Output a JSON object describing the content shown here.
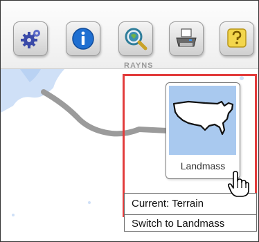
{
  "toolbar": {
    "buttons": [
      {
        "icon": "gear-icon",
        "accent": "#3a4aa8"
      },
      {
        "icon": "info-icon",
        "accent": "#1f6fd1"
      },
      {
        "icon": "magnifier-globe-icon",
        "accent": "#2e7d9a"
      },
      {
        "icon": "printer-icon",
        "accent": "#555555"
      },
      {
        "icon": "help-icon",
        "accent": "#e9c22e"
      }
    ],
    "section_label": "RAYNS"
  },
  "basemap_switcher": {
    "option_label": "Landmass",
    "highlight_color": "#e23c3c",
    "thumbnail_color": "#a9c9ef"
  },
  "tooltip": {
    "current": "Current: Terrain",
    "action": "Switch to Landmass"
  }
}
